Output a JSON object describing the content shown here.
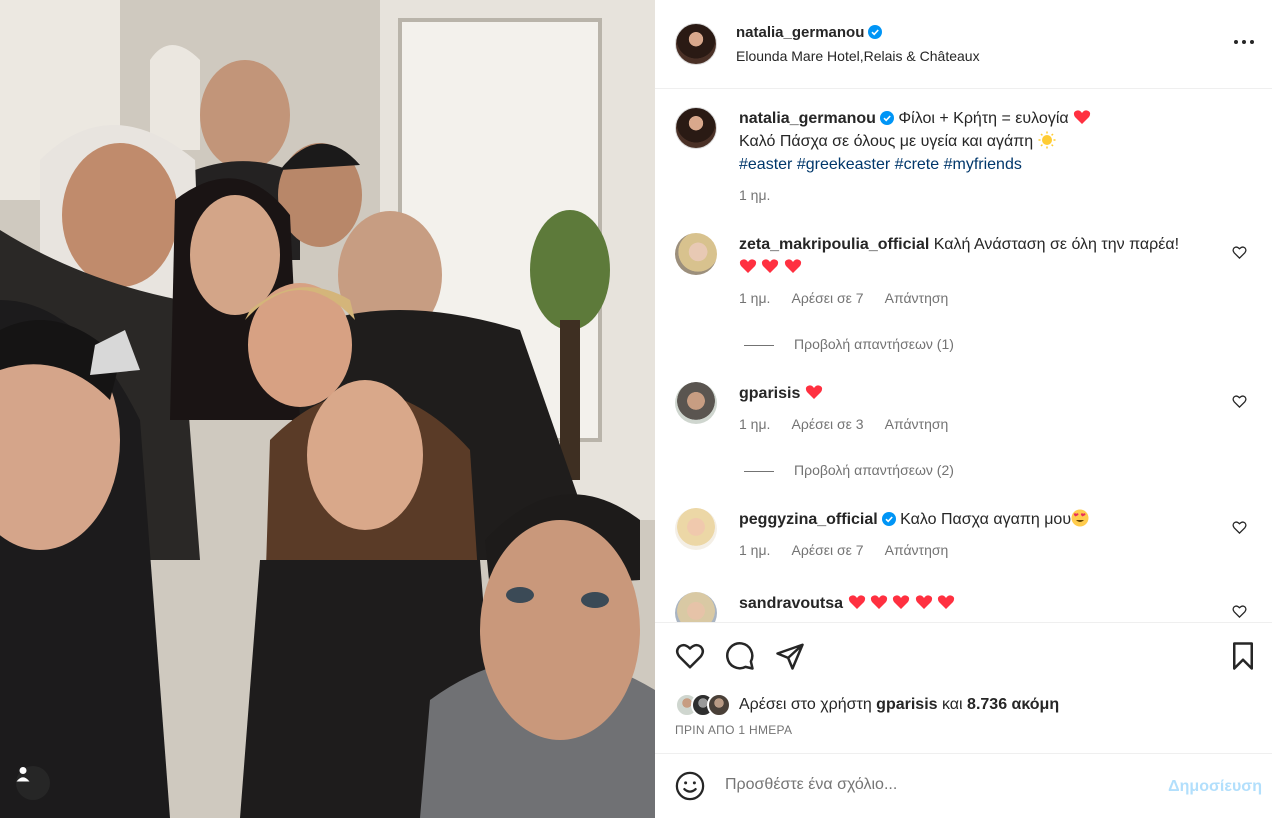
{
  "header": {
    "username": "natalia_germanou",
    "location": "Elounda Mare Hotel,Relais & Châteaux"
  },
  "caption": {
    "username": "natalia_germanou",
    "line1": "Φίλοι + Κρήτη = ευλογία",
    "line2": "Καλό Πάσχα σε όλους με υγεία και αγάπη",
    "hashtags": [
      "#easter",
      "#greekeaster",
      "#crete",
      "#myfriends"
    ],
    "time": "1 ημ."
  },
  "comments": [
    {
      "username": "zeta_makripoulia_official",
      "text": "Καλή Ανάσταση σε όλη την παρέα!",
      "time": "1 ημ.",
      "likes": "Αρέσει σε 7",
      "reply": "Απάντηση",
      "view_replies": "Προβολή απαντήσεων (1)"
    },
    {
      "username": "gparisis",
      "text": "",
      "time": "1 ημ.",
      "likes": "Αρέσει σε 3",
      "reply": "Απάντηση",
      "view_replies": "Προβολή απαντήσεων (2)"
    },
    {
      "username": "peggyzina_official",
      "text": "Καλο Πασχα αγαπη μου",
      "time": "1 ημ.",
      "likes": "Αρέσει σε 7",
      "reply": "Απάντηση"
    },
    {
      "username": "sandravoutsa",
      "text": ""
    }
  ],
  "likes": {
    "prefix": "Αρέσει στο χρήστη",
    "user": "gparisis",
    "conj": "και",
    "others": "8.736 ακόμη"
  },
  "posted_when": "ΠΡΙΝ ΑΠΟ 1 ΗΜΕΡΑ",
  "composer": {
    "placeholder": "Προσθέστε ένα σχόλιο...",
    "post_label": "Δημοσίευση"
  },
  "colors": {
    "verified": "#0095f6",
    "heart": "#ff3040",
    "hashtag": "#00376b",
    "post_disabled": "#b2dffc"
  }
}
